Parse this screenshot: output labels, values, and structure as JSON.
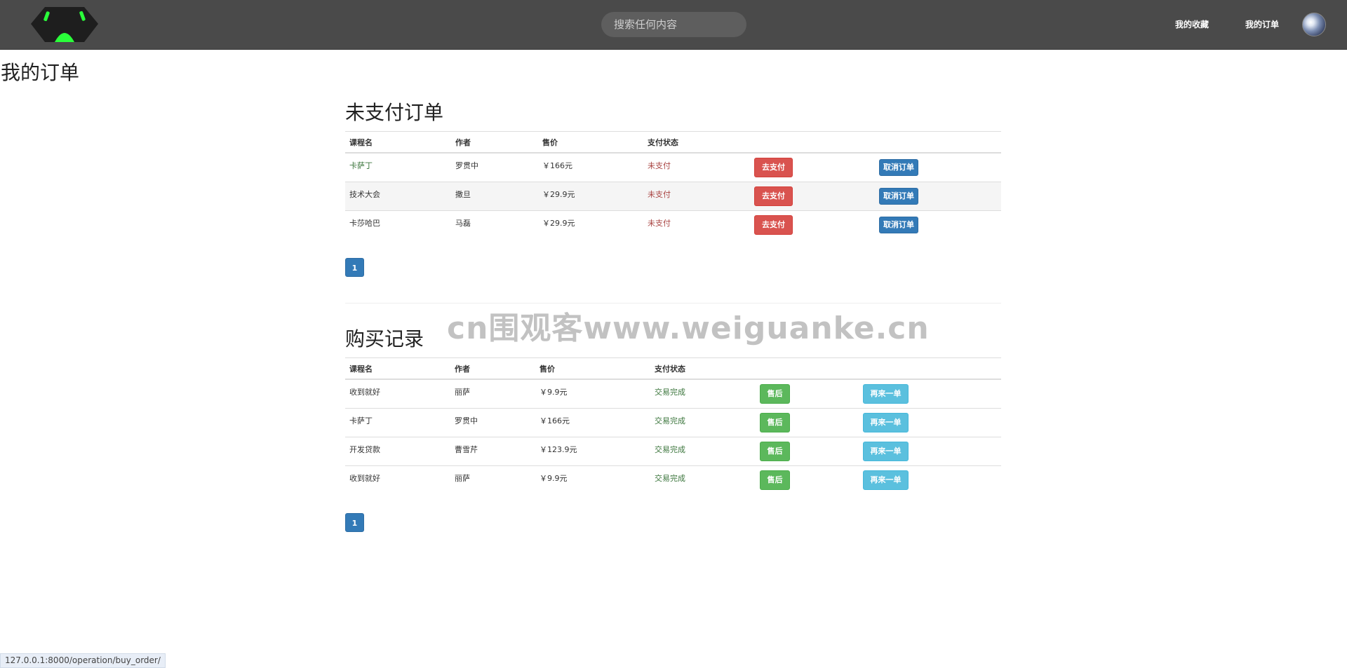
{
  "header": {
    "search_placeholder": "搜索任何内容",
    "nav": {
      "favorites": "我的收藏",
      "orders": "我的订单"
    }
  },
  "page_title": "我的订单",
  "unpaid": {
    "title": "未支付订单",
    "columns": [
      "课程名",
      "作者",
      "售价",
      "支付状态"
    ],
    "rows": [
      {
        "course": "卡萨丁",
        "author": "罗贯中",
        "price": "￥166元",
        "status": "未支付",
        "pay": "去支付",
        "cancel": "取消订单"
      },
      {
        "course": "技术大会",
        "author": "撒旦",
        "price": "￥29.9元",
        "status": "未支付",
        "pay": "去支付",
        "cancel": "取消订单"
      },
      {
        "course": "卡莎哈巴",
        "author": "马磊",
        "price": "￥29.9元",
        "status": "未支付",
        "pay": "去支付",
        "cancel": "取消订单"
      }
    ],
    "page": "1"
  },
  "history": {
    "title": "购买记录",
    "columns": [
      "课程名",
      "作者",
      "售价",
      "支付状态"
    ],
    "rows": [
      {
        "course": "收到就好",
        "author": "丽萨",
        "price": "￥9.9元",
        "status": "交易完成",
        "after": "售后",
        "again": "再来一单"
      },
      {
        "course": "卡萨丁",
        "author": "罗贯中",
        "price": "￥166元",
        "status": "交易完成",
        "after": "售后",
        "again": "再来一单"
      },
      {
        "course": "开发贷款",
        "author": "曹雪芹",
        "price": "￥123.9元",
        "status": "交易完成",
        "after": "售后",
        "again": "再来一单"
      },
      {
        "course": "收到就好",
        "author": "丽萨",
        "price": "￥9.9元",
        "status": "交易完成",
        "after": "售后",
        "again": "再来一单"
      }
    ],
    "page": "1"
  },
  "watermark": "cn围观客www.weiguanke.cn",
  "status_url": "127.0.0.1:8000/operation/buy_order/",
  "colors": {
    "topbar": "#4a4a4a",
    "danger": "#d9534f",
    "primary": "#337ab7",
    "success": "#5cb85c",
    "info": "#5bc0de"
  }
}
